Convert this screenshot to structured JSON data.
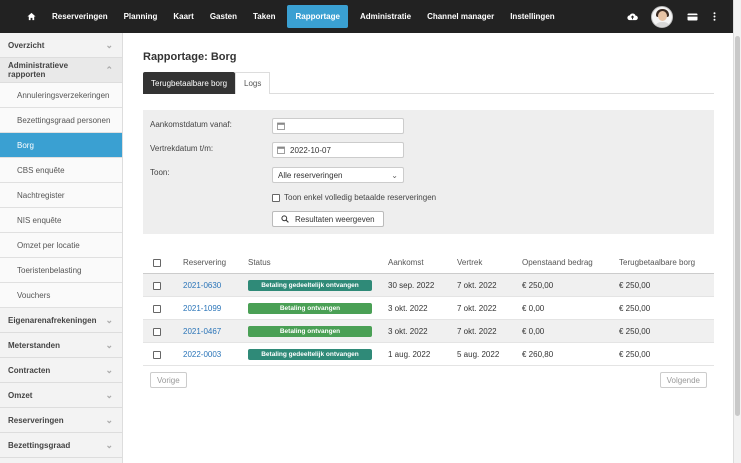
{
  "nav": {
    "items": [
      {
        "label": "Reserveringen",
        "active": false
      },
      {
        "label": "Planning",
        "active": false
      },
      {
        "label": "Kaart",
        "active": false
      },
      {
        "label": "Gasten",
        "active": false
      },
      {
        "label": "Taken",
        "active": false
      },
      {
        "label": "Rapportage",
        "active": true
      },
      {
        "label": "Administratie",
        "active": false
      },
      {
        "label": "Channel manager",
        "active": false
      },
      {
        "label": "Instellingen",
        "active": false
      }
    ]
  },
  "sidebar": {
    "overview": "Overzicht",
    "admin_reports": "Administratieve rapporten",
    "sub": [
      "Annuleringsverzekeringen",
      "Bezettingsgraad personen",
      "Borg",
      "CBS enquête",
      "Nachtregister",
      "NIS enquête",
      "Omzet per locatie",
      "Toeristenbelasting",
      "Vouchers"
    ],
    "groups": [
      "Eigenarenafrekeningen",
      "Meterstanden",
      "Contracten",
      "Omzet",
      "Reserveringen",
      "Bezettingsgraad"
    ]
  },
  "page": {
    "title": "Rapportage: Borg",
    "tab_active": "Terugbetaalbare borg",
    "tab_logs": "Logs"
  },
  "filter": {
    "arrival_from_label": "Aankomstdatum vanaf:",
    "arrival_from_value": "",
    "departure_to_label": "Vertrekdatum t/m:",
    "departure_to_value": "2022-10-07",
    "show_label": "Toon:",
    "show_value": "Alle reserveringen",
    "only_paid_label": "Toon enkel volledig betaalde reserveringen",
    "submit_label": "Resultaten weergeven"
  },
  "table": {
    "headers": [
      "Reservering",
      "Status",
      "Aankomst",
      "Vertrek",
      "Openstaand bedrag",
      "Terugbetaalbare borg"
    ],
    "rows": [
      {
        "id": "2021-0630",
        "status": "Betaling gedeeltelijk ontvangen",
        "arrival": "30 sep. 2022",
        "departure": "7 okt. 2022",
        "outstanding": "€ 250,00",
        "deposit": "€ 250,00"
      },
      {
        "id": "2021-1099",
        "status": "Betaling ontvangen",
        "arrival": "3 okt. 2022",
        "departure": "7 okt. 2022",
        "outstanding": "€ 0,00",
        "deposit": "€ 250,00"
      },
      {
        "id": "2021-0467",
        "status": "Betaling ontvangen",
        "arrival": "3 okt. 2022",
        "departure": "7 okt. 2022",
        "outstanding": "€ 0,00",
        "deposit": "€ 250,00"
      },
      {
        "id": "2022-0003",
        "status": "Betaling gedeeltelijk ontvangen",
        "arrival": "1 aug. 2022",
        "departure": "5 aug. 2022",
        "outstanding": "€ 260,80",
        "deposit": "€ 250,00"
      }
    ]
  },
  "pager": {
    "prev": "Vorige",
    "next": "Volgende"
  },
  "colors": {
    "accent": "#3aa0d2",
    "partial": "#2f8a78",
    "paid": "#4aa055",
    "navbar": "#222222"
  },
  "icons": {
    "home": "home-icon",
    "cloud": "cloud-upload-icon",
    "card": "card-icon",
    "more": "more-vertical-icon"
  }
}
